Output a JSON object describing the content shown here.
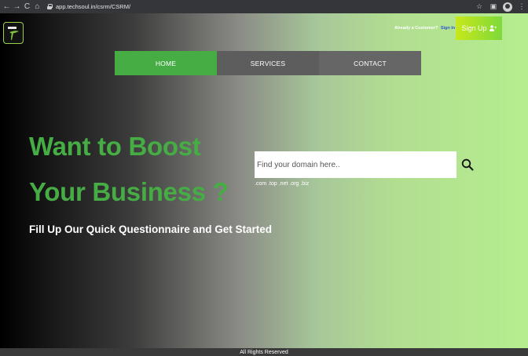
{
  "browser": {
    "url": "app.techsoul.in/csrm/CSRM/",
    "nav_icons": [
      "back-icon",
      "forward-icon",
      "reload-icon",
      "home-icon"
    ],
    "nav_glyphs": [
      "←",
      "→",
      "C",
      "⌂"
    ],
    "right_icons": [
      "star-icon",
      "extension-icon",
      "profile-icon",
      "menu-icon"
    ],
    "right_glyphs": [
      "☆",
      "▣",
      "",
      "⋮"
    ]
  },
  "header": {
    "already_customer": "Already a Customer?",
    "sign_in": "Sign In",
    "sign_up": "Sign Up",
    "sign_up_icon": "add-user-icon",
    "logo_icon": "techsoul-logo-icon"
  },
  "menu": {
    "items": [
      {
        "label": "HOME",
        "active": true
      },
      {
        "label": "SERVICES",
        "active": false
      },
      {
        "label": "CONTACT",
        "active": false
      }
    ]
  },
  "hero": {
    "headline_line1": "Want to Boost",
    "headline_line2": "Your Business ?",
    "subheadline": "Fill Up Our Quick Questionnaire and Get Started"
  },
  "search": {
    "placeholder": "Find your domain here..",
    "value": "",
    "icon": "search-icon",
    "tlds": ".com .top .net .org .biz"
  },
  "footer": {
    "text": "All Rights Reserved"
  },
  "colors": {
    "accent_green": "#46ad45",
    "signup_gradient_start": "#c8e81a",
    "signup_gradient_end": "#7ed93a",
    "sign_in_link": "#2b57d9"
  }
}
